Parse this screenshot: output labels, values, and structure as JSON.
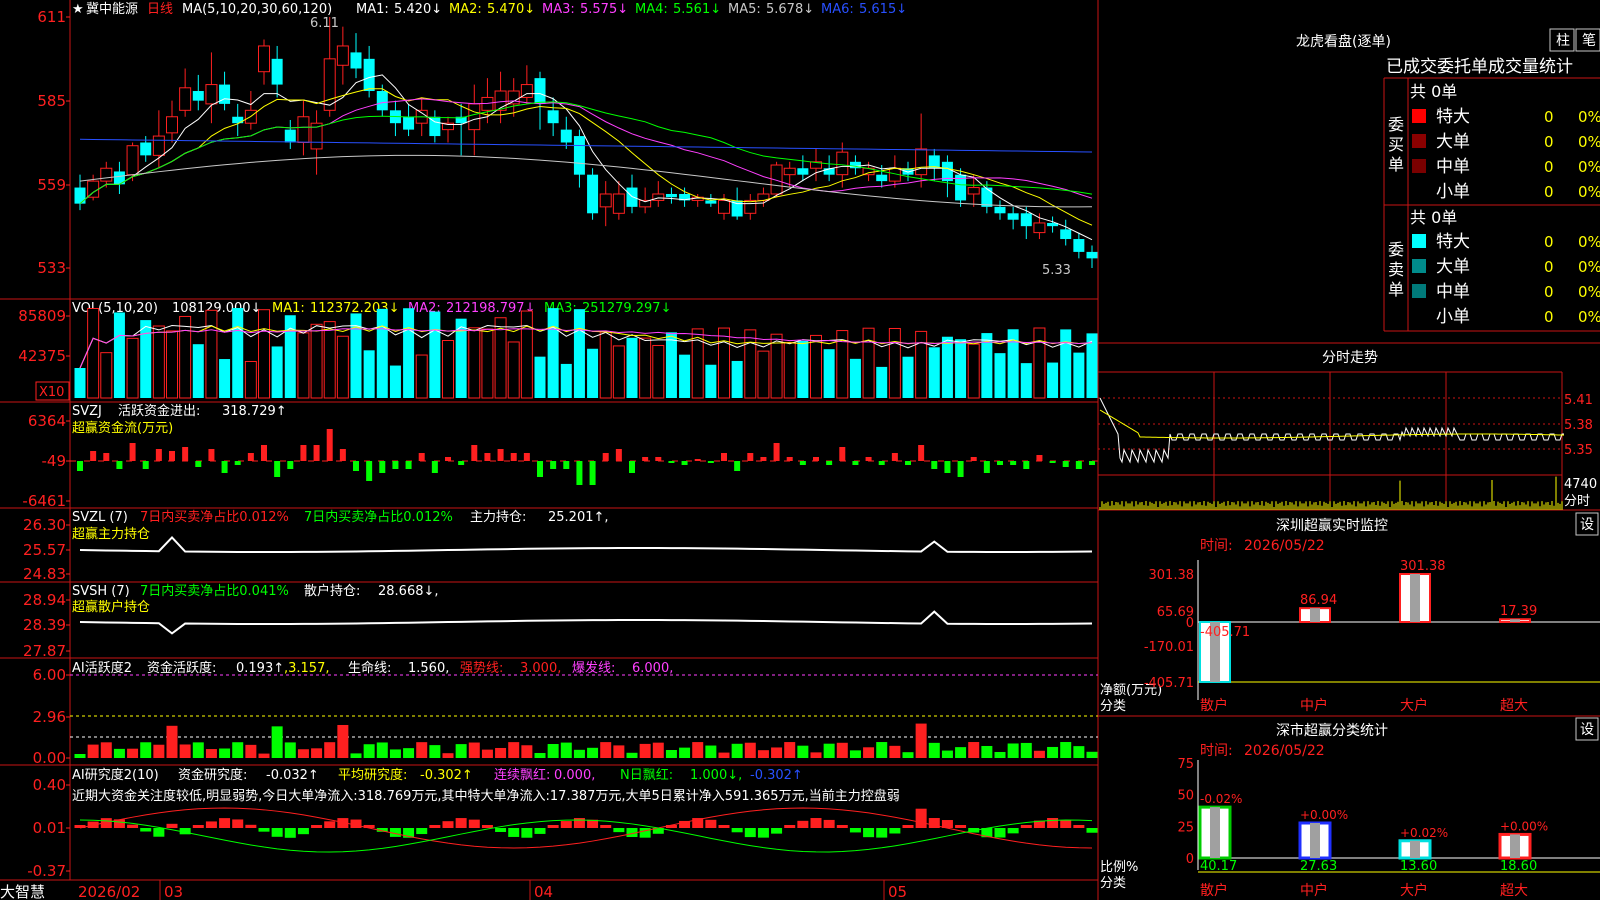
{
  "app": {
    "name": "大智慧",
    "star": "★",
    "stock": "冀中能源",
    "period": "日线"
  },
  "colors": {
    "up": "#ff2020",
    "down": "#00ffff",
    "frame": "#c81414",
    "ma1": "#ffffff",
    "ma2": "#ffff00",
    "ma3": "#ff40ff",
    "ma4": "#00ff00",
    "ma5": "#c8c8c8",
    "ma6": "#2850ff"
  },
  "price_panel": {
    "title": "MA(5,10,20,30,60,120)",
    "ma_labels": [
      {
        "name": "MA1:",
        "value": "5.420↓",
        "color": "#ffffff"
      },
      {
        "name": "MA2:",
        "value": "5.470↓",
        "color": "#ffff00"
      },
      {
        "name": "MA3:",
        "value": "5.575↓",
        "color": "#ff40ff"
      },
      {
        "name": "MA4:",
        "value": "5.561↓",
        "color": "#00ff00"
      },
      {
        "name": "MA5:",
        "value": "5.678↓",
        "color": "#c8c8c8"
      },
      {
        "name": "MA6:",
        "value": "5.615↓",
        "color": "#2850ff"
      }
    ],
    "yticks": [
      "611",
      "585",
      "559",
      "533"
    ],
    "high_mark": "6.11",
    "low_mark": "5.33"
  },
  "vol_panel": {
    "title": "VOL(5,10,20)",
    "value": "108129.000↓",
    "ma_labels": [
      {
        "name": "MA1:",
        "value": "112372.203↓",
        "color": "#ffff00"
      },
      {
        "name": "MA2:",
        "value": "212198.797↓",
        "color": "#ff40ff"
      },
      {
        "name": "MA3:",
        "value": "251279.297↓",
        "color": "#00ff00"
      }
    ],
    "yticks": [
      "85809",
      "42375"
    ],
    "unit": "X10"
  },
  "svzj_panel": {
    "title": "SVZJ",
    "label": "活跃资金进出:",
    "value": "318.729↑",
    "subtitle": "超赢资金流(万元)",
    "yticks": [
      "6364",
      "-49",
      "-6461"
    ]
  },
  "svzl_panel": {
    "title": "SVZL (7)",
    "label1": "7日内买卖净占比0.012%",
    "label2": "7日内买卖净占比0.012%",
    "label3": "主力持仓:",
    "value": "25.201↑,",
    "subtitle": "超赢主力持仓",
    "yticks": [
      "26.30",
      "25.57",
      "24.83"
    ]
  },
  "svsh_panel": {
    "title": "SVSH (7)",
    "label1": "7日内买卖净占比0.041%",
    "label2": "散户持仓:",
    "value": "28.668↓,",
    "subtitle": "超赢散户持仓",
    "yticks": [
      "28.94",
      "28.39",
      "27.87"
    ]
  },
  "ai_active_panel": {
    "title": "AI活跃度2",
    "label1": "资金活跃度:",
    "v1": "0.193↑",
    "v2": ",3.157,",
    "label2": "生命线:",
    "v3": "1.560,",
    "label3": "强势线:",
    "v4": "3.000,",
    "label4": "爆发线:",
    "v5": "6.000,",
    "yticks": [
      "6.00",
      "2.96",
      "0.00"
    ]
  },
  "ai_research_panel": {
    "title": "AI研究度2(10)",
    "label1": "资金研究度:",
    "v1": "-0.032↑",
    "label2": "平均研究度:",
    "v2": "-0.302↑",
    "label3": "连续飘红:",
    "v3": "0.000,",
    "label4": "N日飘红:",
    "v4": "1.000↓,",
    "v5": "-0.302↑",
    "comment": "近期大资金关注度较低,明显弱势,今日大单净流入:318.769万元,其中特大单净流入:17.387万元,大单5日累计净入591.365万元,当前主力控盘弱",
    "yticks": [
      "0.40",
      "0.01",
      "-0.37"
    ]
  },
  "xaxis": {
    "labels": [
      "2026/02",
      "03",
      "04",
      "05"
    ]
  },
  "right": {
    "lhb_title": "龙虎看盘(逐单)",
    "btn_column": "柱",
    "btn_stroke": "笔",
    "deal_title": "已成交委托单成交量统计",
    "buy_side": "委买单",
    "sell_side": "委卖单",
    "buy_total": "共 0单",
    "sell_total": "共 0单",
    "buy_rows": [
      {
        "label": "特大",
        "count": "0",
        "pct": "0%",
        "color": "#ff0000"
      },
      {
        "label": "大单",
        "count": "0",
        "pct": "0%",
        "color": "#8b0000"
      },
      {
        "label": "中单",
        "count": "0",
        "pct": "0%",
        "color": "#7a0000"
      },
      {
        "label": "小单",
        "count": "0",
        "pct": "0%",
        "color": ""
      }
    ],
    "sell_rows": [
      {
        "label": "特大",
        "count": "0",
        "pct": "0%",
        "color": "#00ffff"
      },
      {
        "label": "大单",
        "count": "0",
        "pct": "0%",
        "color": "#008b8b"
      },
      {
        "label": "中单",
        "count": "0",
        "pct": "0%",
        "color": "#007a7a"
      },
      {
        "label": "小单",
        "count": "0",
        "pct": "0%",
        "color": ""
      }
    ],
    "minute_title": "分时走势",
    "minute_yticks": [
      "5.41",
      "5.38",
      "5.35"
    ],
    "minute_vol": "4740",
    "minute_vol_unit": "分时",
    "sz_monitor_title": "深圳超赢实时监控",
    "set_label": "设",
    "time_label": "时间:",
    "time_value": "2026/05/22",
    "net_label": "净额(万元)",
    "cat_label": "分类",
    "monitor_yticks": [
      "301.38",
      "65.69",
      "0",
      "-170.01",
      "-405.71"
    ],
    "monitor_bars": [
      {
        "cat": "散户",
        "value": -405.71,
        "label": "-405.71"
      },
      {
        "cat": "中户",
        "value": 86.94,
        "label": "86.94"
      },
      {
        "cat": "大户",
        "value": 301.38,
        "label": "301.38"
      },
      {
        "cat": "超大",
        "value": 17.39,
        "label": "17.39"
      }
    ],
    "sz_stats_title": "深市超赢分类统计",
    "ratio_label": "比例%",
    "stats_yticks": [
      "75",
      "50",
      "25",
      "0"
    ],
    "stats_bars": [
      {
        "cat": "散户",
        "value": 40.17,
        "label": "40.17",
        "pct": "-0.02%",
        "fill": "#00cc00"
      },
      {
        "cat": "中户",
        "value": 27.63,
        "label": "27.63",
        "pct": "+0.00%",
        "fill": "#2030ff"
      },
      {
        "cat": "大户",
        "value": 13.6,
        "label": "13.60",
        "pct": "+0.02%",
        "fill": "#00e0e0"
      },
      {
        "cat": "超大",
        "value": 18.6,
        "label": "18.60",
        "pct": "+0.00%",
        "fill": "#ff2020"
      }
    ]
  },
  "chart_data": {
    "type": "candlestick",
    "x_axis_months": [
      "2026/02",
      "03",
      "04",
      "05"
    ],
    "ylim": [
      5.3,
      6.15
    ],
    "candles": [
      [
        5.58,
        5.53,
        5.51,
        5.62
      ],
      [
        5.55,
        5.6,
        5.54,
        5.62
      ],
      [
        5.6,
        5.64,
        5.58,
        5.66
      ],
      [
        5.63,
        5.59,
        5.56,
        5.66
      ],
      [
        5.62,
        5.71,
        5.6,
        5.72
      ],
      [
        5.72,
        5.68,
        5.66,
        5.74
      ],
      [
        5.68,
        5.74,
        5.64,
        5.82
      ],
      [
        5.75,
        5.8,
        5.72,
        5.85
      ],
      [
        5.82,
        5.89,
        5.8,
        5.95
      ],
      [
        5.88,
        5.85,
        5.82,
        5.93
      ],
      [
        5.84,
        5.9,
        5.78,
        6.0
      ],
      [
        5.9,
        5.84,
        5.82,
        5.94
      ],
      [
        5.8,
        5.78,
        5.74,
        5.84
      ],
      [
        5.78,
        5.82,
        5.76,
        5.88
      ],
      [
        5.94,
        6.02,
        5.9,
        6.04
      ],
      [
        5.98,
        5.9,
        5.86,
        6.02
      ],
      [
        5.76,
        5.72,
        5.7,
        5.79
      ],
      [
        5.72,
        5.8,
        5.68,
        5.85
      ],
      [
        5.7,
        5.78,
        5.62,
        5.82
      ],
      [
        5.82,
        5.98,
        5.8,
        6.11
      ],
      [
        5.96,
        6.02,
        5.9,
        6.08
      ],
      [
        6.0,
        5.95,
        5.92,
        6.06
      ],
      [
        5.98,
        5.88,
        5.86,
        6.02
      ],
      [
        5.88,
        5.82,
        5.8,
        5.9
      ],
      [
        5.82,
        5.78,
        5.74,
        5.85
      ],
      [
        5.8,
        5.76,
        5.74,
        5.84
      ],
      [
        5.78,
        5.82,
        5.74,
        5.86
      ],
      [
        5.8,
        5.74,
        5.72,
        5.82
      ],
      [
        5.76,
        5.78,
        5.72,
        5.8
      ],
      [
        5.8,
        5.78,
        5.68,
        5.84
      ],
      [
        5.76,
        5.84,
        5.68,
        5.9
      ],
      [
        5.82,
        5.86,
        5.78,
        5.92
      ],
      [
        5.82,
        5.88,
        5.78,
        5.94
      ],
      [
        5.84,
        5.88,
        5.8,
        5.92
      ],
      [
        5.86,
        5.9,
        5.84,
        5.96
      ],
      [
        5.92,
        5.84,
        5.76,
        5.94
      ],
      [
        5.82,
        5.78,
        5.74,
        5.86
      ],
      [
        5.76,
        5.72,
        5.7,
        5.8
      ],
      [
        5.74,
        5.62,
        5.58,
        5.76
      ],
      [
        5.62,
        5.5,
        5.48,
        5.64
      ],
      [
        5.52,
        5.56,
        5.46,
        5.6
      ],
      [
        5.5,
        5.56,
        5.48,
        5.6
      ],
      [
        5.58,
        5.52,
        5.5,
        5.62
      ],
      [
        5.52,
        5.54,
        5.5,
        5.58
      ],
      [
        5.54,
        5.56,
        5.52,
        5.6
      ],
      [
        5.56,
        5.55,
        5.53,
        5.58
      ],
      [
        5.56,
        5.54,
        5.52,
        5.58
      ],
      [
        5.54,
        5.55,
        5.52,
        5.56
      ],
      [
        5.54,
        5.53,
        5.52,
        5.56
      ],
      [
        5.5,
        5.54,
        5.48,
        5.56
      ],
      [
        5.54,
        5.49,
        5.48,
        5.58
      ],
      [
        5.5,
        5.54,
        5.48,
        5.56
      ],
      [
        5.54,
        5.56,
        5.52,
        5.58
      ],
      [
        5.56,
        5.65,
        5.55,
        5.66
      ],
      [
        5.62,
        5.64,
        5.58,
        5.66
      ],
      [
        5.64,
        5.62,
        5.6,
        5.68
      ],
      [
        5.64,
        5.66,
        5.6,
        5.7
      ],
      [
        5.64,
        5.62,
        5.6,
        5.68
      ],
      [
        5.62,
        5.69,
        5.58,
        5.72
      ],
      [
        5.66,
        5.64,
        5.62,
        5.68
      ],
      [
        5.62,
        5.64,
        5.6,
        5.66
      ],
      [
        5.62,
        5.6,
        5.58,
        5.65
      ],
      [
        5.6,
        5.64,
        5.58,
        5.68
      ],
      [
        5.64,
        5.62,
        5.6,
        5.66
      ],
      [
        5.62,
        5.7,
        5.58,
        5.81
      ],
      [
        5.68,
        5.64,
        5.6,
        5.7
      ],
      [
        5.66,
        5.6,
        5.55,
        5.68
      ],
      [
        5.62,
        5.54,
        5.52,
        5.64
      ],
      [
        5.56,
        5.58,
        5.52,
        5.62
      ],
      [
        5.58,
        5.52,
        5.5,
        5.6
      ],
      [
        5.52,
        5.5,
        5.48,
        5.54
      ],
      [
        5.5,
        5.48,
        5.45,
        5.52
      ],
      [
        5.5,
        5.46,
        5.42,
        5.52
      ],
      [
        5.44,
        5.47,
        5.42,
        5.5
      ],
      [
        5.47,
        5.46,
        5.44,
        5.49
      ],
      [
        5.45,
        5.42,
        5.4,
        5.48
      ],
      [
        5.42,
        5.38,
        5.36,
        5.44
      ],
      [
        5.38,
        5.36,
        5.33,
        5.4
      ]
    ]
  }
}
